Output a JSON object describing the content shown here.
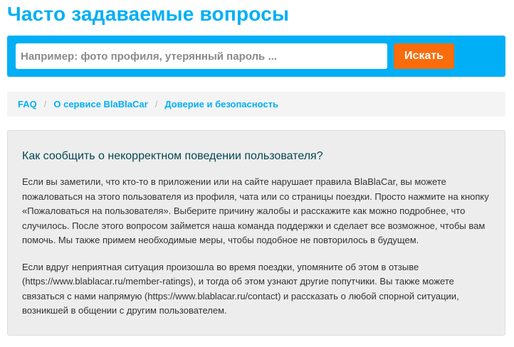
{
  "header": {
    "title": "Часто задаваемые вопросы"
  },
  "search": {
    "placeholder": "Например: фото профиля, утерянный пароль ...",
    "value": "",
    "button_label": "Искать"
  },
  "breadcrumb": {
    "items": [
      {
        "label": "FAQ"
      },
      {
        "label": "О сервисе BlaBlaCar"
      },
      {
        "label": "Доверие и безопасность"
      }
    ],
    "separator": "/"
  },
  "article": {
    "question": "Как сообщить о некорректном поведении пользователя?",
    "paragraphs": [
      "Если вы заметили, что кто-то в приложении или на сайте нарушает правила BlaBlaCar, вы можете пожаловаться на этого пользователя из профиля, чата или со страницы поездки. Просто нажмите на кнопку «Пожаловаться на пользователя». Выберите причину жалобы и расскажите как можно подробнее, что случилось. После этого вопросом займется наша команда поддержки и сделает все возможное, чтобы вам помочь. Мы также примем необходимые меры, чтобы подобное не повторилось в будущем.",
      "Если вдруг неприятная ситуация произошла во время поездки, упомяните об этом в отзыве (https://www.blablacar.ru/member-ratings), и тогда об этом узнают другие попутчики. Вы также можете связаться с нами напрямую (https://www.blablacar.ru/contact) и рассказать о любой спорной ситуации, возникшей в общении с другим пользователем."
    ]
  },
  "colors": {
    "accent": "#00aff5",
    "button": "#f96c0b",
    "heading": "#054752",
    "panel": "#ededed",
    "breadcrumb_bg": "#f4f4f4"
  }
}
